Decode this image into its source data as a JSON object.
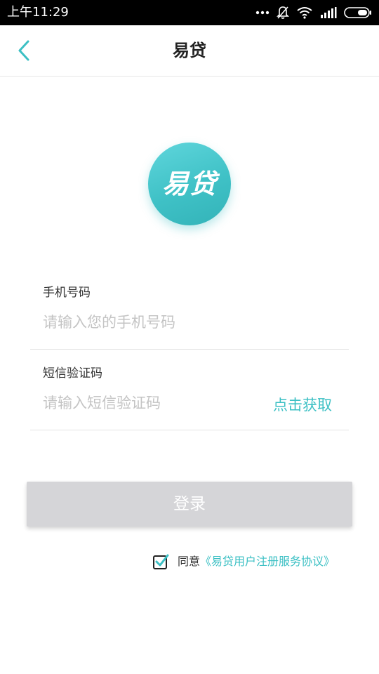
{
  "status_bar": {
    "time": "上午11:29",
    "icons": [
      "more-dots-icon",
      "bell-muted-icon",
      "wifi-icon",
      "signal-icon",
      "battery-icon"
    ]
  },
  "header": {
    "title": "易贷",
    "back_icon": "chevron-left-icon"
  },
  "logo": {
    "text": "易贷"
  },
  "form": {
    "phone_label": "手机号码",
    "phone_placeholder": "请输入您的手机号码",
    "phone_value": "",
    "sms_label": "短信验证码",
    "sms_placeholder": "请输入短信验证码",
    "sms_value": "",
    "get_code_label": "点击获取"
  },
  "login": {
    "label": "登录",
    "enabled": false
  },
  "agreement": {
    "checked": true,
    "prefix": "同意",
    "link_text": "《易贷用户注册服务协议》"
  },
  "colors": {
    "accent": "#3cc0c4",
    "button_disabled": "#d5d5d8",
    "placeholder": "#c4c4c4"
  }
}
